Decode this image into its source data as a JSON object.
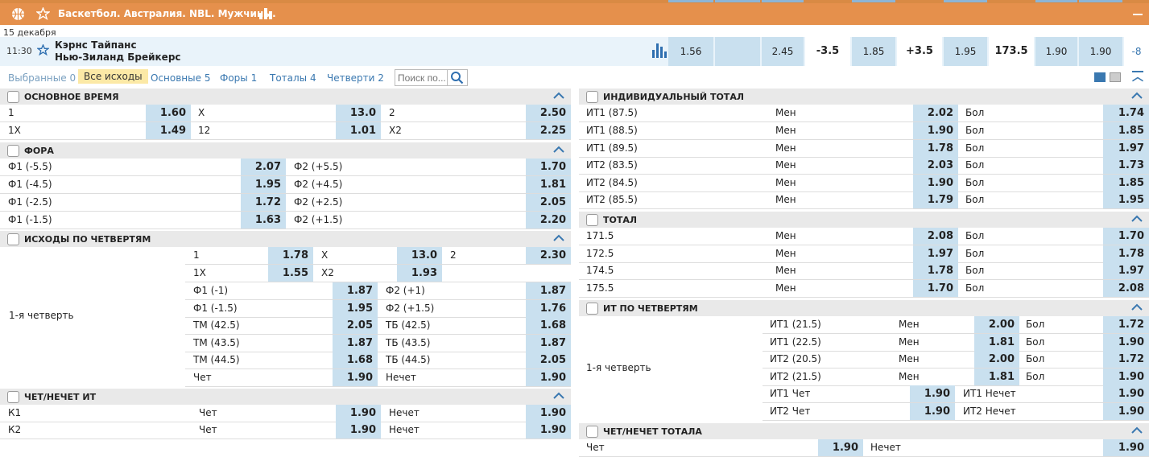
{
  "header": {
    "title": "Баскетбол. Австралия. NBL. Мужчины."
  },
  "date": "15 декабря",
  "match": {
    "time": "11:30",
    "team1": "Кэрнс Тайпанс",
    "team2": "Нью-Зиланд Брейкерс",
    "odds": [
      "1.56",
      "",
      "2.45",
      "-3.5",
      "1.85",
      "+3.5",
      "1.95",
      "173.5",
      "1.90",
      "1.90",
      "-8"
    ]
  },
  "filters": {
    "favorites": "Выбранные 0",
    "all": "Все исходы",
    "main": "Основные 5",
    "handicaps": "Форы 1",
    "totals": "Тоталы 4",
    "quarters": "Четверти 2",
    "search_placeholder": "Поиск по..."
  },
  "left": {
    "main_time": {
      "title": "ОСНОВНОЕ ВРЕМЯ",
      "rows": [
        [
          "1",
          "1.60",
          "X",
          "13.0",
          "2",
          "2.50"
        ],
        [
          "1X",
          "1.49",
          "12",
          "1.01",
          "X2",
          "2.25"
        ]
      ]
    },
    "handicap": {
      "title": "ФОРА",
      "rows": [
        [
          "Ф1 (-5.5)",
          "2.07",
          "Ф2 (+5.5)",
          "1.70"
        ],
        [
          "Ф1 (-4.5)",
          "1.95",
          "Ф2 (+4.5)",
          "1.81"
        ],
        [
          "Ф1 (-2.5)",
          "1.72",
          "Ф2 (+2.5)",
          "2.05"
        ],
        [
          "Ф1 (-1.5)",
          "1.63",
          "Ф2 (+1.5)",
          "2.20"
        ]
      ]
    },
    "quarters": {
      "title": "ИСХОДЫ ПО ЧЕТВЕРТЯМ",
      "label": "1-я четверть",
      "top": [
        [
          "1",
          "1.78",
          "X",
          "13.0",
          "2",
          "2.30"
        ],
        [
          "1X",
          "1.55",
          "X2",
          "1.93",
          "",
          ""
        ]
      ],
      "rows": [
        [
          "Ф1 (-1)",
          "1.87",
          "Ф2 (+1)",
          "1.87"
        ],
        [
          "Ф1 (-1.5)",
          "1.95",
          "Ф2 (+1.5)",
          "1.76"
        ],
        [
          "ТМ (42.5)",
          "2.05",
          "ТБ (42.5)",
          "1.68"
        ],
        [
          "ТМ (43.5)",
          "1.87",
          "ТБ (43.5)",
          "1.87"
        ],
        [
          "ТМ (44.5)",
          "1.68",
          "ТБ (44.5)",
          "2.05"
        ],
        [
          "Чет",
          "1.90",
          "Нечет",
          "1.90"
        ]
      ]
    },
    "evenodd": {
      "title": "ЧЕТ/НЕЧЕТ ИТ",
      "rows": [
        [
          "К1",
          "Чет",
          "1.90",
          "Нечет",
          "1.90"
        ],
        [
          "К2",
          "Чет",
          "1.90",
          "Нечет",
          "1.90"
        ]
      ]
    }
  },
  "right": {
    "ind_total": {
      "title": "ИНДИВИДУАЛЬНЫЙ ТОТАЛ",
      "rows": [
        [
          "ИТ1 (87.5)",
          "Мен",
          "2.02",
          "Бол",
          "1.74"
        ],
        [
          "ИТ1 (88.5)",
          "Мен",
          "1.90",
          "Бол",
          "1.85"
        ],
        [
          "ИТ1 (89.5)",
          "Мен",
          "1.78",
          "Бол",
          "1.97"
        ],
        [
          "ИТ2 (83.5)",
          "Мен",
          "2.03",
          "Бол",
          "1.73"
        ],
        [
          "ИТ2 (84.5)",
          "Мен",
          "1.90",
          "Бол",
          "1.85"
        ],
        [
          "ИТ2 (85.5)",
          "Мен",
          "1.79",
          "Бол",
          "1.95"
        ]
      ]
    },
    "total": {
      "title": "ТОТАЛ",
      "rows": [
        [
          "171.5",
          "Мен",
          "2.08",
          "Бол",
          "1.70"
        ],
        [
          "172.5",
          "Мен",
          "1.97",
          "Бол",
          "1.78"
        ],
        [
          "174.5",
          "Мен",
          "1.78",
          "Бол",
          "1.97"
        ],
        [
          "175.5",
          "Мен",
          "1.70",
          "Бол",
          "2.08"
        ]
      ]
    },
    "it_quarters": {
      "title": "ИТ ПО ЧЕТВЕРТЯМ",
      "label": "1-я четверть",
      "rows": [
        [
          "ИТ1 (21.5)",
          "Мен",
          "2.00",
          "Бол",
          "1.72"
        ],
        [
          "ИТ1 (22.5)",
          "Мен",
          "1.81",
          "Бол",
          "1.90"
        ],
        [
          "ИТ2 (20.5)",
          "Мен",
          "2.00",
          "Бол",
          "1.72"
        ],
        [
          "ИТ2 (21.5)",
          "Мен",
          "1.81",
          "Бол",
          "1.90"
        ]
      ],
      "even": [
        [
          "ИТ1 Чет",
          "1.90",
          "ИТ1 Нечет",
          "1.90"
        ],
        [
          "ИТ2 Чет",
          "1.90",
          "ИТ2 Нечет",
          "1.90"
        ]
      ]
    },
    "total_evenodd": {
      "title": "ЧЕТ/НЕЧЕТ ТОТАЛА",
      "row": [
        "Чет",
        "1.90",
        "Нечет",
        "1.90"
      ]
    }
  }
}
